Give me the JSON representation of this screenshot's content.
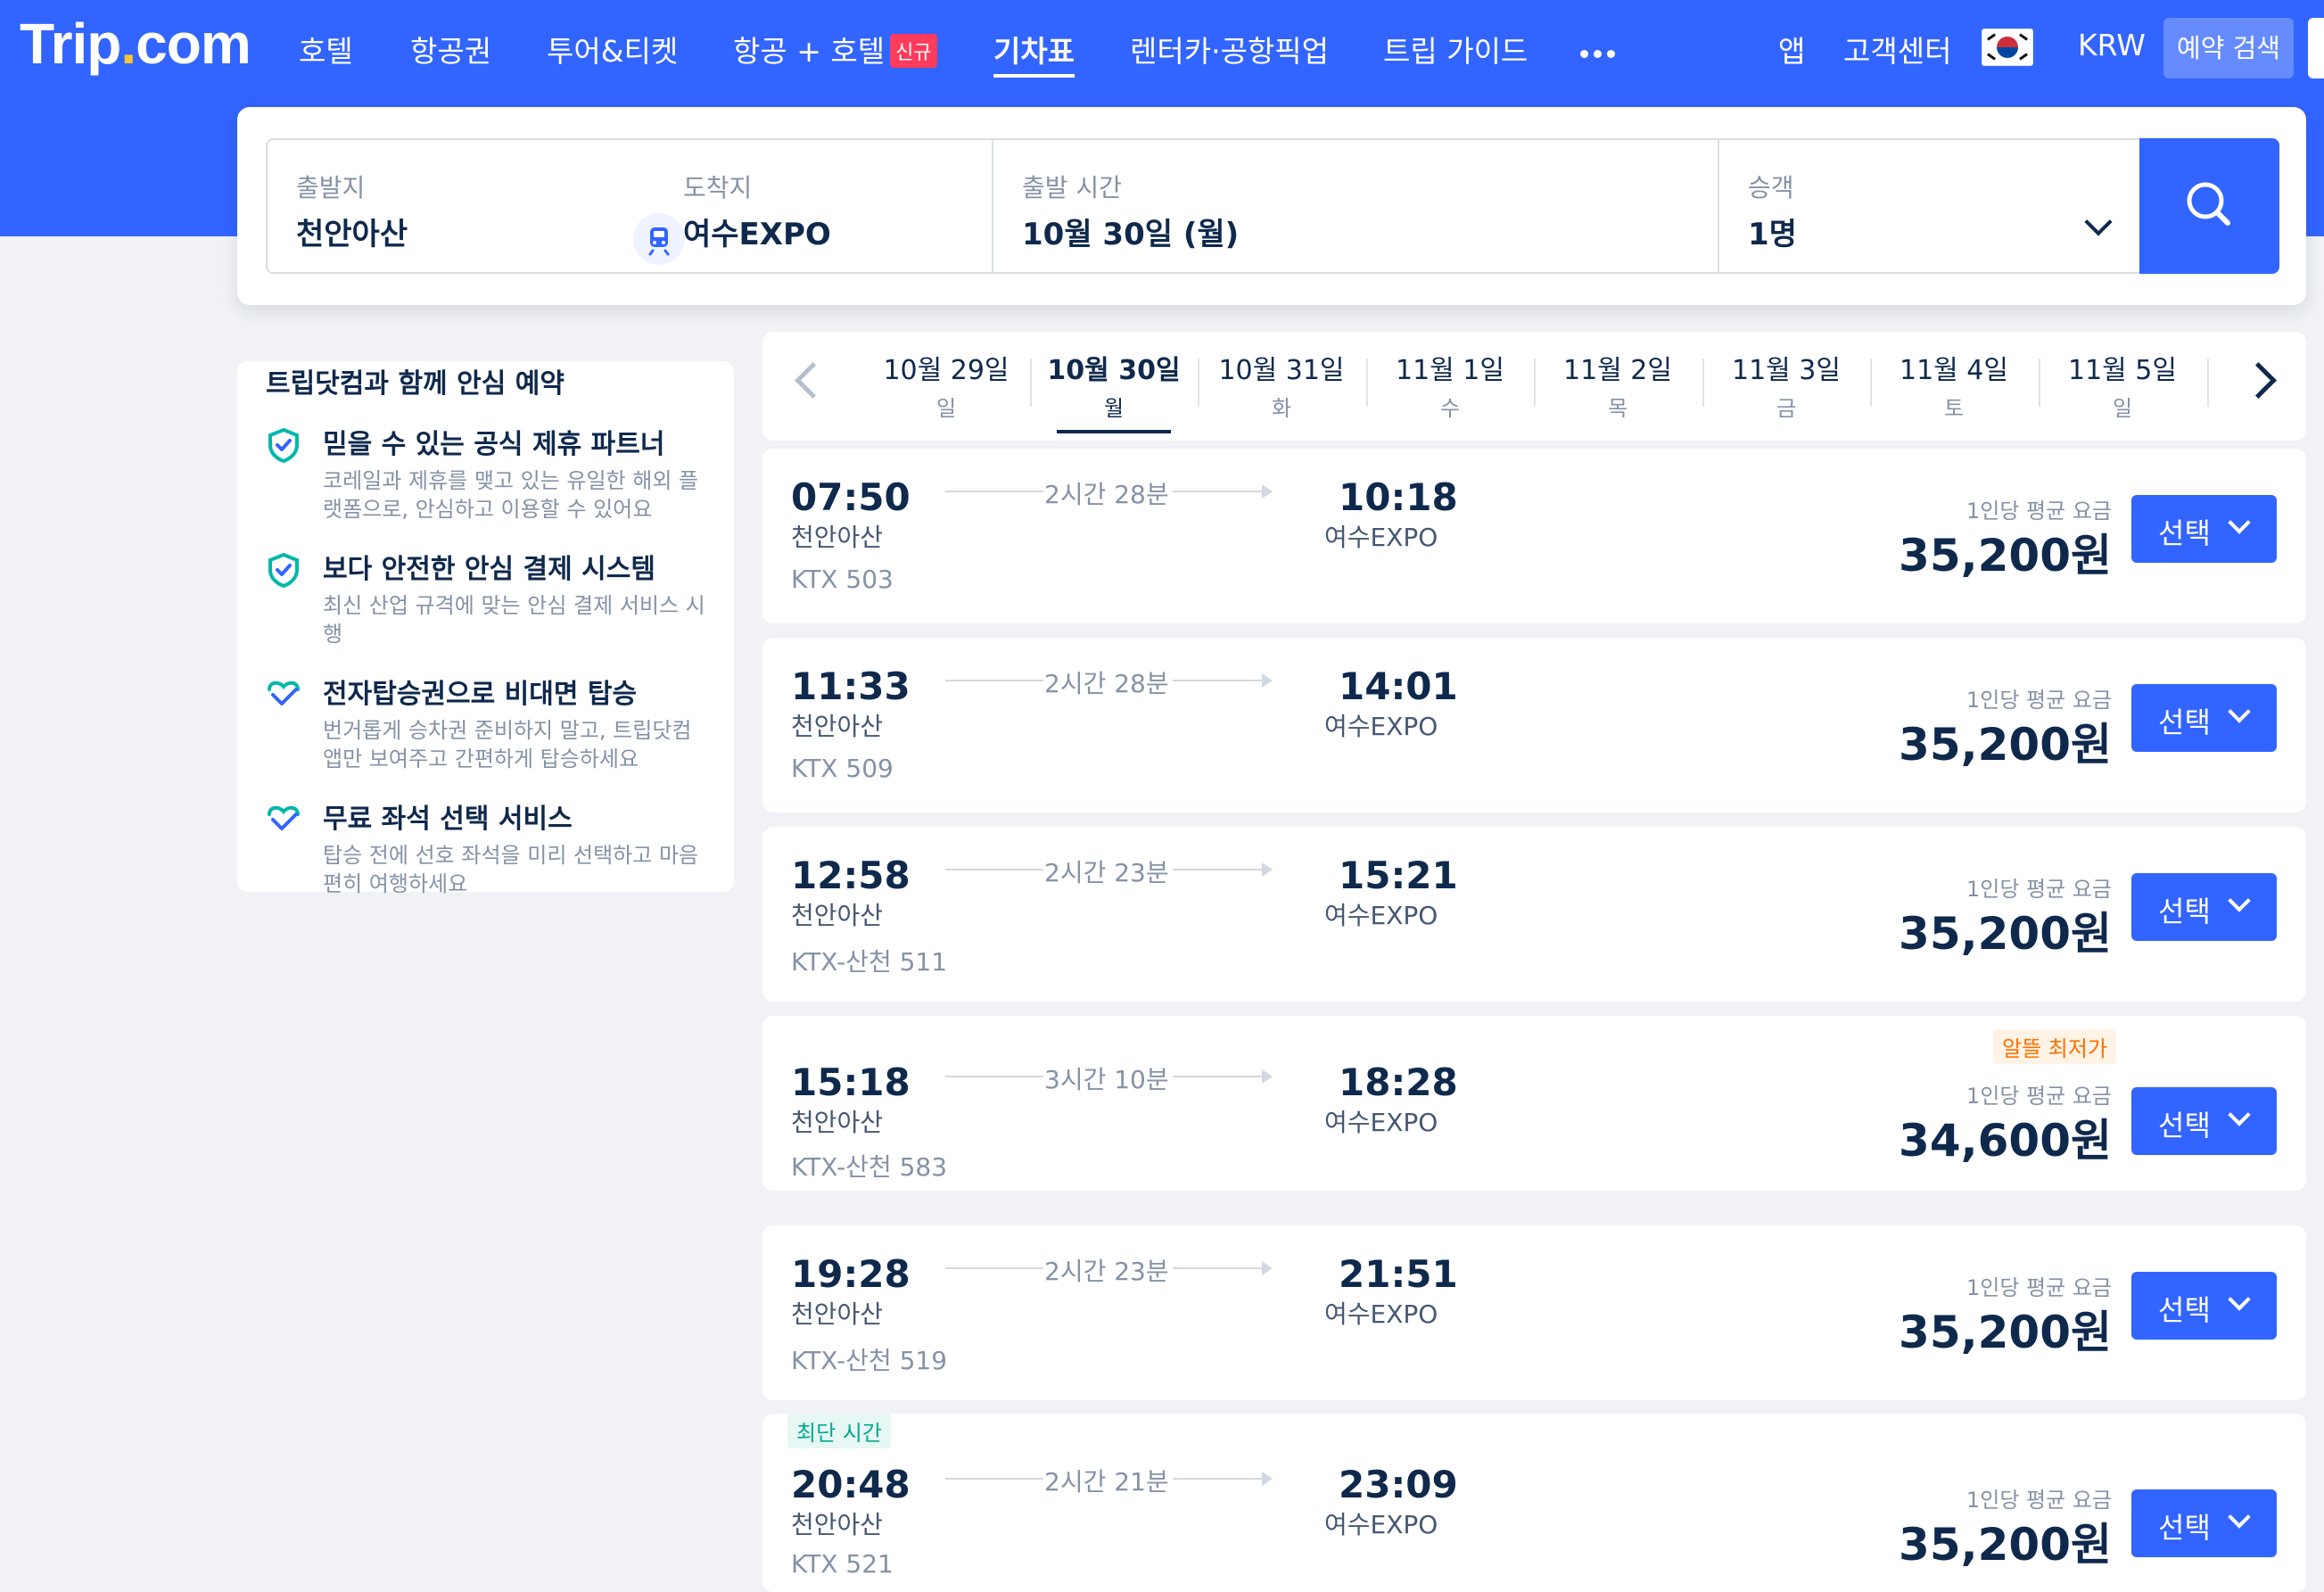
{
  "brand": {
    "name_main": "Trip",
    "name_dot": ".",
    "name_tail": "com"
  },
  "nav": {
    "items": [
      "호텔",
      "항공권",
      "투어&티켓",
      "항공 + 호텔",
      "기차표",
      "렌터카·공항픽업",
      "트립 가이드"
    ],
    "new_badge": "신규",
    "active_index": 4,
    "app": "앱",
    "support": "고객센터",
    "currency": "KRW",
    "reservation_search": "예약 검색"
  },
  "search": {
    "from_label": "출발지",
    "from_value": "천안아산",
    "to_label": "도착지",
    "to_value": "여수EXPO",
    "time_label": "출발 시간",
    "time_value": "10월 30일 (월)",
    "passenger_label": "승객",
    "passenger_value": "1명"
  },
  "sidebar": {
    "title": "트립닷컴과 함께 안심 예약",
    "items": [
      {
        "heading": "믿을 수 있는 공식 제휴 파트너",
        "desc": "코레일과 제휴를 맺고 있는 유일한 해외 플랫폼으로, 안심하고 이용할 수 있어요"
      },
      {
        "heading": "보다 안전한 안심 결제 시스템",
        "desc": "최신 산업 규격에 맞는 안심 결제 서비스 시행"
      },
      {
        "heading": "전자탑승권으로 비대면 탑승",
        "desc": "번거롭게 승차권 준비하지 말고, 트립닷컴 앱만 보여주고 간편하게 탑승하세요"
      },
      {
        "heading": "무료 좌석 선택 서비스",
        "desc": "탑승 전에 선호 좌석을 미리 선택하고 마음 편히 여행하세요"
      }
    ]
  },
  "dates": [
    {
      "date": "10월 29일",
      "day": "일"
    },
    {
      "date": "10월 30일",
      "day": "월"
    },
    {
      "date": "10월 31일",
      "day": "화"
    },
    {
      "date": "11월 1일",
      "day": "수"
    },
    {
      "date": "11월 2일",
      "day": "목"
    },
    {
      "date": "11월 3일",
      "day": "금"
    },
    {
      "date": "11월 4일",
      "day": "토"
    },
    {
      "date": "11월 5일",
      "day": "일"
    }
  ],
  "active_date_index": 1,
  "price_label": "1인당 평균 요금",
  "select_label": "선택",
  "trains": [
    {
      "dep": "07:50",
      "arr": "10:18",
      "from": "천안아산",
      "to": "여수EXPO",
      "duration": "2시간 28분",
      "train": "KTX 503",
      "price": "35,200원"
    },
    {
      "dep": "11:33",
      "arr": "14:01",
      "from": "천안아산",
      "to": "여수EXPO",
      "duration": "2시간 28분",
      "train": "KTX 509",
      "price": "35,200원"
    },
    {
      "dep": "12:58",
      "arr": "15:21",
      "from": "천안아산",
      "to": "여수EXPO",
      "duration": "2시간 23분",
      "train": "KTX-산천 511",
      "price": "35,200원"
    },
    {
      "dep": "15:18",
      "arr": "18:28",
      "from": "천안아산",
      "to": "여수EXPO",
      "duration": "3시간 10분",
      "train": "KTX-산천 583",
      "price": "34,600원",
      "tag": "알뜰 최저가"
    },
    {
      "dep": "19:28",
      "arr": "21:51",
      "from": "천안아산",
      "to": "여수EXPO",
      "duration": "2시간 23분",
      "train": "KTX-산천 519",
      "price": "35,200원"
    },
    {
      "dep": "20:48",
      "arr": "23:09",
      "from": "천안아산",
      "to": "여수EXPO",
      "duration": "2시간 21분",
      "train": "KTX 521",
      "price": "35,200원",
      "tag": "최단 시간"
    }
  ],
  "colors": {
    "brand_blue": "#3264ff",
    "navy": "#0f294d",
    "cheap_tag": "#ff6f00",
    "fast_tag": "#00a98f"
  }
}
